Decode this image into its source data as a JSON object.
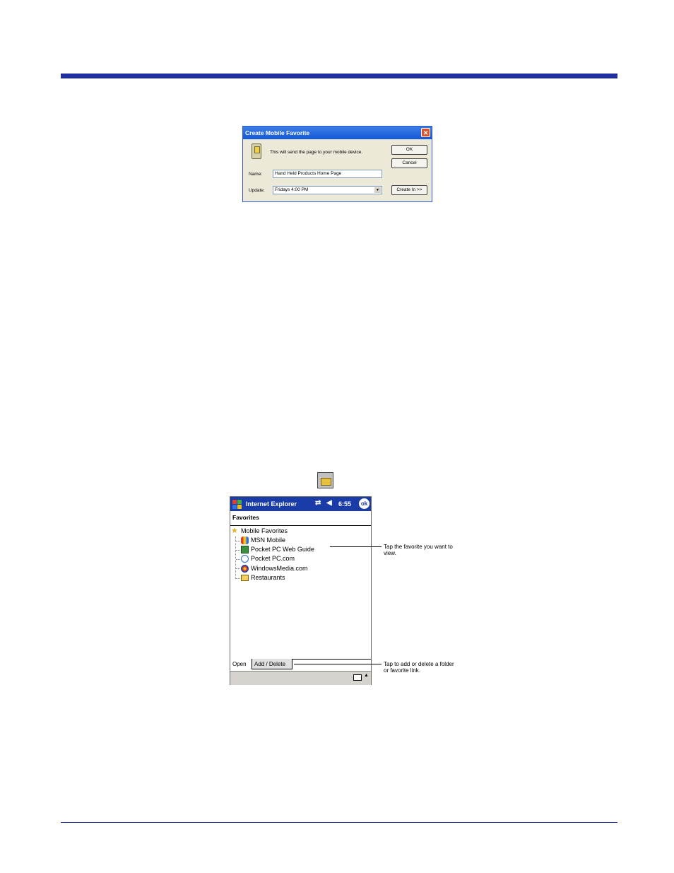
{
  "dialog": {
    "title": "Create Mobile Favorite",
    "close_glyph": "✕",
    "message": "This will send the page to your mobile device.",
    "name_label": "Name:",
    "name_value": "Hand Held Products Home Page",
    "update_label": "Update:",
    "update_value": "Fridays 4:00 PM",
    "ok_label": "OK",
    "cancel_label": "Cancel",
    "create_in_label": "Create In >>"
  },
  "ppc": {
    "app_title": "Internet Explorer",
    "time": "6:55",
    "ok_label": "ok",
    "header": "Favorites",
    "items": [
      {
        "label": "Mobile Favorites",
        "icon": "star-icon"
      },
      {
        "label": "MSN Mobile",
        "icon": "msn-butterfly-icon"
      },
      {
        "label": "Pocket PC Web Guide",
        "icon": "web-guide-icon"
      },
      {
        "label": "Pocket PC.com",
        "icon": "clock-icon"
      },
      {
        "label": "WindowsMedia.com",
        "icon": "media-icon"
      },
      {
        "label": "Restaurants",
        "icon": "folder-icon"
      }
    ],
    "tabs": [
      "Open",
      "Add / Delete"
    ]
  },
  "callouts": {
    "favorite": "Tap the favorite you want to view.",
    "add_delete": "Tap to add or delete a folder or favorite link."
  },
  "colors": {
    "accent": "#1f2fa0",
    "ppc_bar": "#1a3ca8"
  }
}
